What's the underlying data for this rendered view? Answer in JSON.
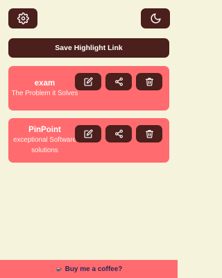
{
  "toolbar": {
    "settings_icon": "gear-icon",
    "theme_icon": "moon-icon"
  },
  "save_button": {
    "label": "Save Highlight Link"
  },
  "highlights": [
    {
      "title": "exam",
      "description": "The Problem it Solves"
    },
    {
      "title": "PinPoint",
      "description": "exceptional Software solutions"
    }
  ],
  "card_actions": [
    "edit-icon",
    "share-icon",
    "trash-icon"
  ],
  "footer": {
    "label": "Buy me a coffee?",
    "icon": "coffee-cup-icon"
  },
  "colors": {
    "background": "#f5f3dc",
    "dark": "#4a1f1c",
    "accent": "#ff6b6e",
    "footer_text": "#2a2a5a"
  }
}
